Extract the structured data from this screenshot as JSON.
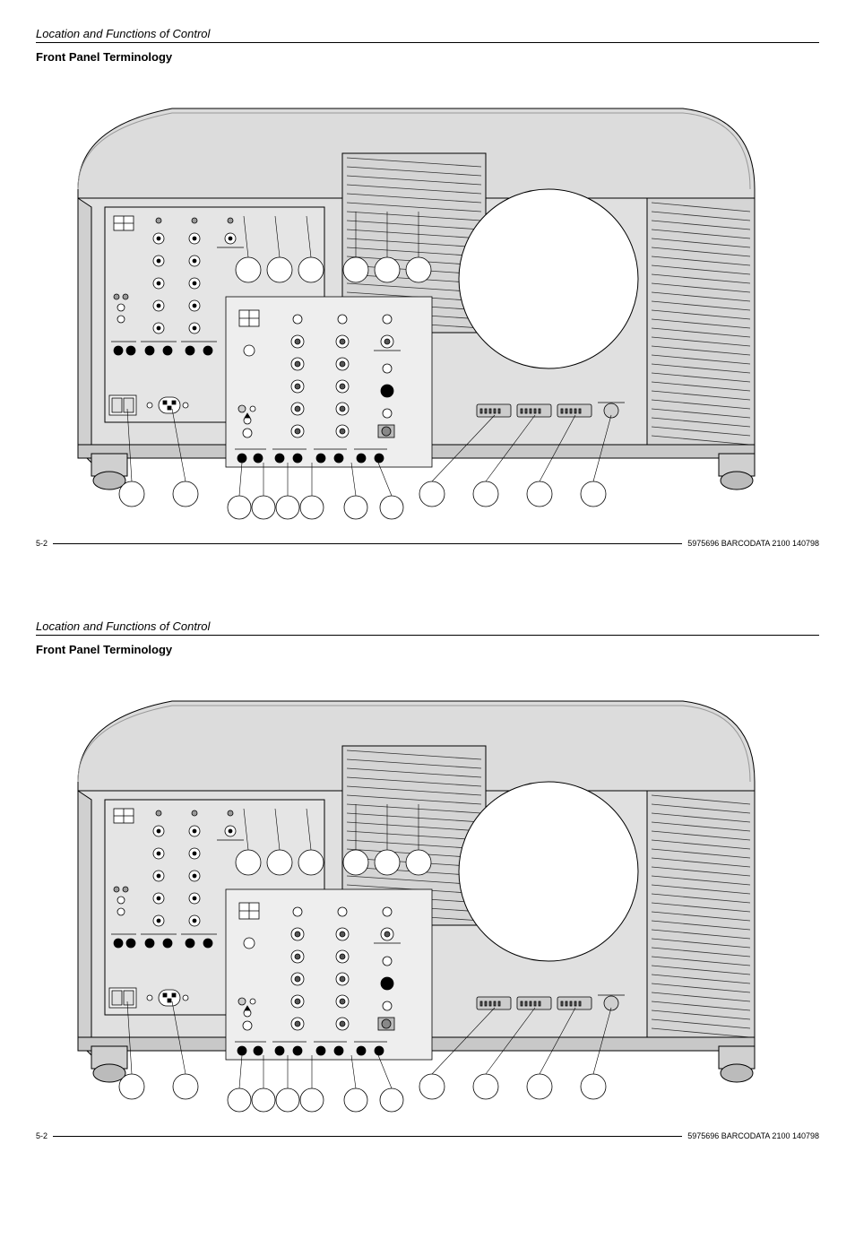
{
  "section_header": "Location and Functions of Control",
  "section_title": "Front Panel Terminology",
  "page_number": "5-2",
  "footer_code": "5975696 BARCODATA 2100 140798"
}
